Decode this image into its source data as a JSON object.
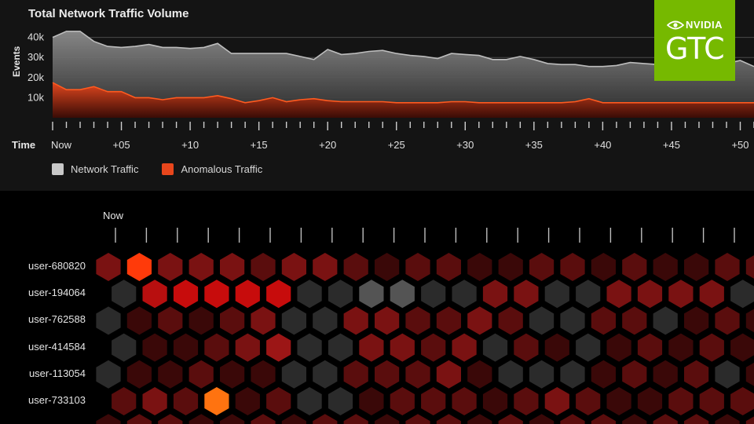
{
  "chart_data": [
    {
      "type": "area",
      "title": "Total Network Traffic Volume",
      "ylabel": "Events",
      "xlabel": "Time",
      "y_ticks": [
        "10k",
        "20k",
        "30k",
        "40k"
      ],
      "ylim": [
        0,
        50000
      ],
      "x_tick_labels": [
        "Now",
        "+05",
        "+10",
        "+15",
        "+20",
        "+25",
        "+30",
        "+35",
        "+40",
        "+45",
        "+50"
      ],
      "grid": true,
      "legend_position": "bottom-left",
      "series": [
        {
          "name": "Network Traffic",
          "color": "#c8c8c8",
          "values": [
            40000,
            43000,
            43000,
            38000,
            35500,
            35000,
            35500,
            36500,
            35000,
            35000,
            34500,
            35000,
            37000,
            32000,
            32000,
            32000,
            32000,
            32000,
            30500,
            29000,
            34000,
            31500,
            32000,
            33000,
            33500,
            32000,
            31000,
            30500,
            29500,
            32000,
            31500,
            31000,
            29000,
            29000,
            30500,
            29000,
            27000,
            26500,
            26500,
            25500,
            25500,
            26000,
            27500,
            27000,
            26500,
            26500,
            26500,
            27000,
            27500,
            27000,
            28500,
            25500
          ]
        },
        {
          "name": "Anomalous Traffic",
          "color": "#e8461c",
          "values": [
            17500,
            14000,
            14000,
            15500,
            13000,
            13000,
            10000,
            10000,
            9000,
            10000,
            10000,
            10000,
            11000,
            9500,
            7500,
            8500,
            10000,
            8000,
            9000,
            9500,
            8500,
            8000,
            8000,
            8000,
            8000,
            7500,
            7500,
            7500,
            7500,
            8000,
            8000,
            7500,
            7500,
            7500,
            7500,
            7500,
            7500,
            7500,
            8000,
            9500,
            7500,
            7500,
            7500,
            7500,
            7500,
            7500,
            7500,
            7500,
            7500,
            7500,
            7500,
            7500
          ]
        }
      ]
    },
    {
      "type": "heatmap",
      "x_label": "Now",
      "rows": [
        "user-680820",
        "user-194064",
        "user-762588",
        "user-414584",
        "user-113054",
        "user-733103"
      ],
      "palette": {
        "0": "#2b2b2b",
        "1": "#3a0808",
        "2": "#5a0d0d",
        "3": "#7a1212",
        "4": "#9c1616",
        "5": "#b80f0f",
        "6": "#c70c0c",
        "7": "#ff3a0a",
        "8": "#ff7310",
        "9": "#545454"
      },
      "values": [
        [
          3,
          7,
          3,
          3,
          3,
          2,
          3,
          3,
          2,
          1,
          2,
          2,
          1,
          1,
          2,
          2,
          1,
          2,
          1,
          1,
          2,
          2,
          1,
          1,
          2
        ],
        [
          0,
          5,
          6,
          6,
          6,
          6,
          0,
          0,
          9,
          9,
          0,
          0,
          3,
          3,
          0,
          0,
          3,
          3,
          3,
          3,
          0,
          0,
          3,
          3,
          0
        ],
        [
          0,
          1,
          2,
          1,
          2,
          3,
          0,
          0,
          3,
          3,
          2,
          2,
          3,
          2,
          0,
          0,
          2,
          2,
          0,
          1,
          2,
          1,
          0,
          0,
          2
        ],
        [
          0,
          1,
          1,
          2,
          3,
          4,
          0,
          0,
          3,
          3,
          2,
          3,
          0,
          2,
          1,
          0,
          1,
          2,
          1,
          2,
          1,
          2,
          1,
          2,
          1
        ],
        [
          0,
          1,
          1,
          2,
          1,
          1,
          0,
          0,
          2,
          2,
          2,
          3,
          1,
          0,
          0,
          0,
          1,
          2,
          1,
          2,
          0,
          1,
          1,
          0,
          0
        ],
        [
          2,
          3,
          2,
          8,
          1,
          2,
          0,
          0,
          1,
          2,
          2,
          2,
          1,
          2,
          3,
          2,
          1,
          1,
          2,
          2,
          2,
          0,
          1,
          2,
          2
        ],
        [
          1,
          2,
          2,
          1,
          1,
          2,
          1,
          2,
          2,
          1,
          2,
          2,
          1,
          2,
          1,
          2,
          2,
          1,
          2,
          2,
          1,
          2,
          2,
          1,
          2
        ]
      ]
    }
  ],
  "badge": {
    "brand": "NVIDIA",
    "event": "GTC"
  }
}
